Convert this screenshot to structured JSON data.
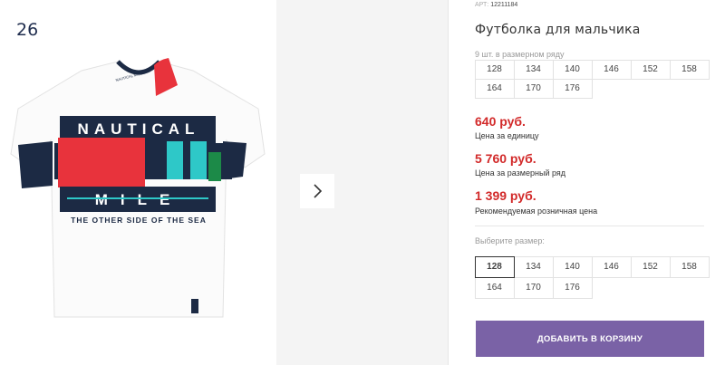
{
  "gallery": {
    "image_number": "26",
    "shirt_print": {
      "top_word": "NAUTICAL",
      "bottom_word": "MILE",
      "tagline": "THE OTHER SIDE OF THE SEA",
      "neck_tape": "NAUTICAL MILE"
    },
    "next_icon": "chevron-right-icon"
  },
  "product": {
    "article_label": "АРТ:",
    "article_number": "12211184",
    "title": "Футболка для мальчика",
    "row_note": "9 шт. в размерном ряду",
    "row_sizes": [
      "128",
      "134",
      "140",
      "146",
      "152",
      "158",
      "164",
      "170",
      "176"
    ],
    "prices": [
      {
        "value": "640 руб.",
        "label": "Цена за единицу"
      },
      {
        "value": "5 760 руб.",
        "label": "Цена за размерный ряд"
      },
      {
        "value": "1 399 руб.",
        "label": "Рекомендуемая розничная цена"
      }
    ],
    "choose_label": "Выберите размер:",
    "select_sizes": [
      "128",
      "134",
      "140",
      "146",
      "152",
      "158",
      "164",
      "170",
      "176"
    ],
    "selected_size": "128",
    "cart_button": "ДОБАВИТЬ В КОРЗИНУ"
  },
  "colors": {
    "price": "#d22a2a",
    "button": "#7a62a6",
    "navy": "#1c2a44",
    "red": "#e8333c",
    "teal": "#2ec8c8"
  }
}
